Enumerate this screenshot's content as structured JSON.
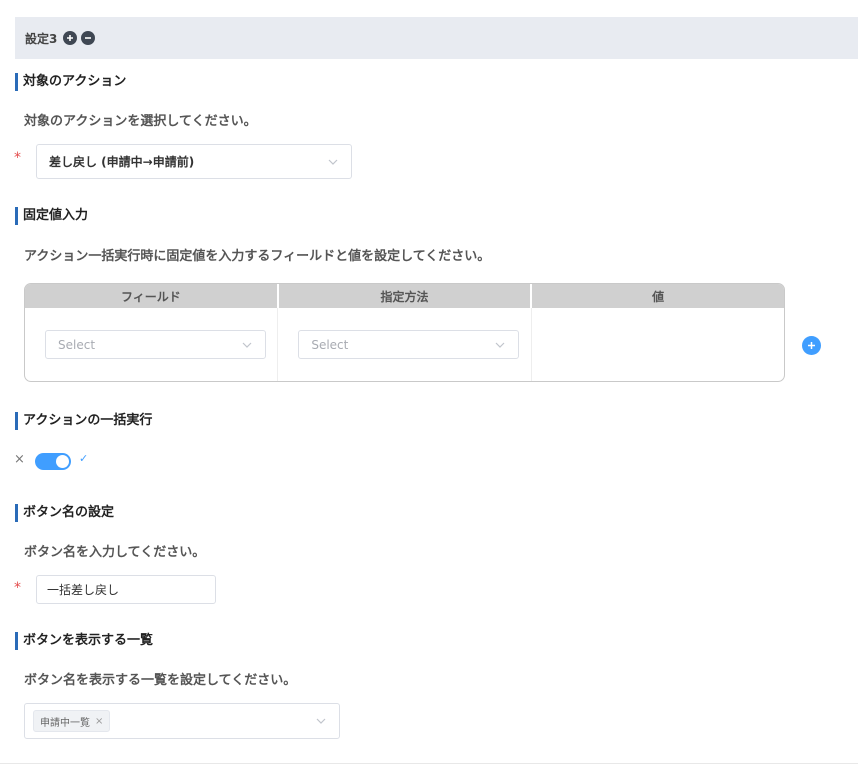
{
  "header": {
    "title": "設定3",
    "add_icon": "plus-circle-icon",
    "remove_icon": "minus-circle-icon"
  },
  "target_action": {
    "title": "対象のアクション",
    "description": "対象のアクションを選択してください。",
    "required_mark": "*",
    "selected": "差し戻し (申請中→申請前)"
  },
  "fixed_value": {
    "title": "固定値入力",
    "description": "アクション一括実行時に固定値を入力するフィールドと値を設定してください。",
    "columns": [
      "フィールド",
      "指定方法",
      "値"
    ],
    "rows": [
      {
        "field_placeholder": "Select",
        "method_placeholder": "Select"
      }
    ]
  },
  "bulk_execute": {
    "title": "アクションの一括実行",
    "off_mark": "×",
    "on_mark": "✓",
    "enabled": true
  },
  "button_name": {
    "title": "ボタン名の設定",
    "description": "ボタン名を入力してください。",
    "required_mark": "*",
    "value": "一括差し戻し"
  },
  "button_list": {
    "title": "ボタンを表示する一覧",
    "description": "ボタン名を表示する一覧を設定してください。",
    "tags": [
      "申請中一覧"
    ],
    "tag_close": "×"
  },
  "colors": {
    "accent": "#409eff",
    "section_bar": "#2a6bb8",
    "required": "#e34b4b"
  }
}
